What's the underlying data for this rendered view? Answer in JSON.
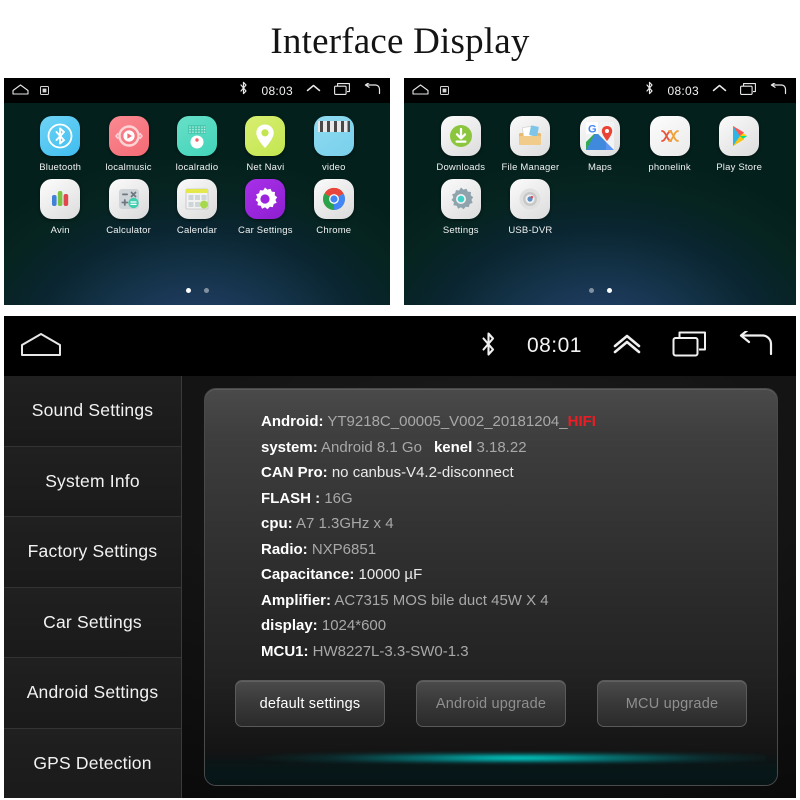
{
  "title": "Interface Display",
  "panels": {
    "home1": {
      "statusbar": {
        "home_icon": "home-icon",
        "screenshot_icon": "screenshot-icon",
        "bluetooth_icon": "bluetooth-icon",
        "clock": "08:03",
        "expand_icon": "chevron-up-icon",
        "recents_icon": "recents-icon",
        "back_icon": "back-arrow-icon"
      },
      "apps": [
        {
          "label": "Bluetooth",
          "icon": "bluetooth-app-icon"
        },
        {
          "label": "localmusic",
          "icon": "localmusic-app-icon"
        },
        {
          "label": "localradio",
          "icon": "localradio-app-icon"
        },
        {
          "label": "Net Navi",
          "icon": "net-navi-app-icon"
        },
        {
          "label": "video",
          "icon": "video-app-icon"
        },
        {
          "label": "Avin",
          "icon": "avin-app-icon"
        },
        {
          "label": "Calculator",
          "icon": "calculator-app-icon"
        },
        {
          "label": "Calendar",
          "icon": "calendar-app-icon"
        },
        {
          "label": "Car Settings",
          "icon": "car-settings-app-icon"
        },
        {
          "label": "Chrome",
          "icon": "chrome-app-icon"
        }
      ],
      "page_dots": {
        "count": 2,
        "active": 0
      }
    },
    "home2": {
      "statusbar": {
        "home_icon": "home-icon",
        "screenshot_icon": "screenshot-icon",
        "bluetooth_icon": "bluetooth-icon",
        "clock": "08:03",
        "expand_icon": "chevron-up-icon",
        "recents_icon": "recents-icon",
        "back_icon": "back-arrow-icon"
      },
      "apps": [
        {
          "label": "Downloads",
          "icon": "downloads-app-icon"
        },
        {
          "label": "File Manager",
          "icon": "file-manager-app-icon"
        },
        {
          "label": "Maps",
          "icon": "maps-app-icon"
        },
        {
          "label": "phonelink",
          "icon": "phonelink-app-icon"
        },
        {
          "label": "Play Store",
          "icon": "play-store-app-icon"
        },
        {
          "label": "Settings",
          "icon": "settings-app-icon"
        },
        {
          "label": "USB-DVR",
          "icon": "usb-dvr-app-icon"
        }
      ],
      "page_dots": {
        "count": 2,
        "active": 1
      }
    },
    "settings": {
      "statusbar": {
        "home_icon": "home-icon",
        "bluetooth_icon": "bluetooth-icon",
        "clock": "08:01",
        "expand_icon": "chevron-up-icon",
        "recents_icon": "recents-icon",
        "back_icon": "back-arrow-icon"
      },
      "sidebar": [
        {
          "label": "Sound Settings"
        },
        {
          "label": "System Info"
        },
        {
          "label": "Factory Settings"
        },
        {
          "label": "Car Settings"
        },
        {
          "label": "Android Settings"
        },
        {
          "label": "GPS Detection"
        }
      ],
      "info": {
        "android_key": "Android:",
        "android_value": "YT9218C_00005_V002_20181204_",
        "android_value_hifi": "HIFI",
        "system_key": "system:",
        "system_value": "Android 8.1 Go",
        "kernel_key": "kenel",
        "kernel_value": "3.18.22",
        "canpro_key": "CAN Pro:",
        "canpro_value": "no canbus-V4.2-disconnect",
        "flash_key": "FLASH :",
        "flash_value": "16G",
        "cpu_key": "cpu:",
        "cpu_value": "A7 1.3GHz x 4",
        "radio_key": "Radio:",
        "radio_value": "NXP6851",
        "capacitance_key": "Capacitance:",
        "capacitance_value": "10000 µF",
        "amplifier_key": "Amplifier:",
        "amplifier_value": "AC7315 MOS bile duct 45W X 4",
        "display_key": "display:",
        "display_value": "1024*600",
        "mcu1_key": "MCU1:",
        "mcu1_value": "HW8227L-3.3-SW0-1.3"
      },
      "buttons": {
        "default_settings": "default settings",
        "android_upgrade": "Android upgrade",
        "mcu_upgrade": "MCU upgrade"
      }
    }
  },
  "colors": {
    "hifi_red": "#ec1c24",
    "glow_cyan": "#00f0e6",
    "panel_bg": "#06231f",
    "sidebar_bg": "#1c1c1c"
  }
}
